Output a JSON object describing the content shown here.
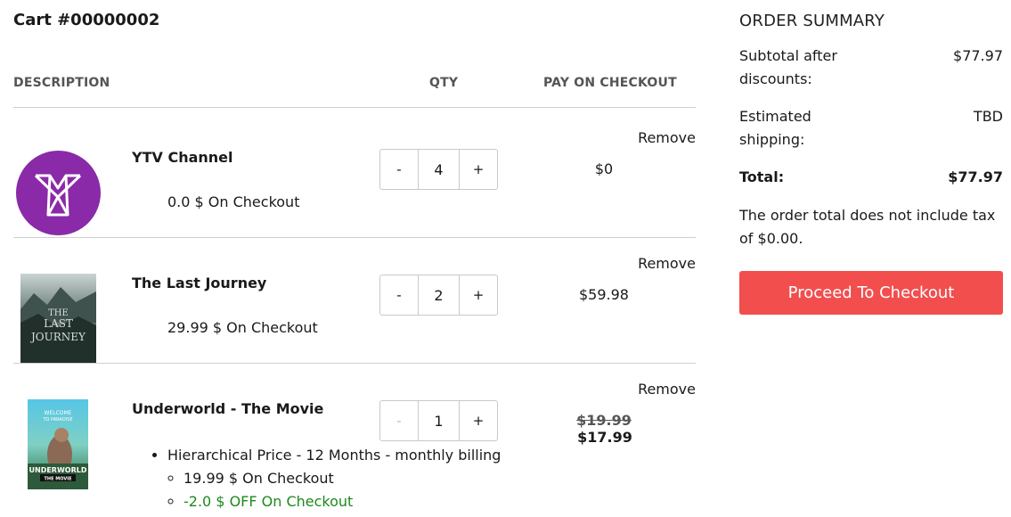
{
  "cart": {
    "title": "Cart #00000002"
  },
  "columns": {
    "description": "DESCRIPTION",
    "qty": "QTY",
    "pay": "PAY ON CHECKOUT"
  },
  "items": [
    {
      "name": "YTV Channel",
      "checkout": "0.0 $ On Checkout",
      "remove": "Remove",
      "minus": "-",
      "plus": "+",
      "qty": "4",
      "price": "$0",
      "thumb_color": "#8a2aa8"
    },
    {
      "name": "The Last Journey",
      "checkout": "29.99 $ On Checkout",
      "remove": "Remove",
      "minus": "-",
      "plus": "+",
      "qty": "2",
      "price": "$59.98",
      "poster_text": [
        "THE",
        "LAST",
        "JOURNEY"
      ]
    },
    {
      "name": "Underworld - The Movie",
      "remove": "Remove",
      "minus": "-",
      "plus": "+",
      "qty": "1",
      "price_old": "$19.99",
      "price_new": "$17.99",
      "bullet": "Hierarchical Price - 12 Months - monthly billing",
      "sub_checkout": "19.99 $ On Checkout",
      "sub_discount": "-2.0 $ OFF On Checkout",
      "poster_text": [
        "WELCOME",
        "TO PARADISE",
        "UNDERWORLD",
        "THE MOVIE"
      ],
      "discount_color": "#1d8a1d"
    }
  ],
  "summary": {
    "title": "ORDER SUMMARY",
    "subtotal_label": "Subtotal after discounts:",
    "subtotal_value": "$77.97",
    "shipping_label": "Estimated shipping:",
    "shipping_value": "TBD",
    "total_label": "Total:",
    "total_value": "$77.97",
    "tax_note": "The order total does not include tax of $0.00.",
    "checkout_button": "Proceed To Checkout",
    "button_color": "#f24e4e"
  }
}
